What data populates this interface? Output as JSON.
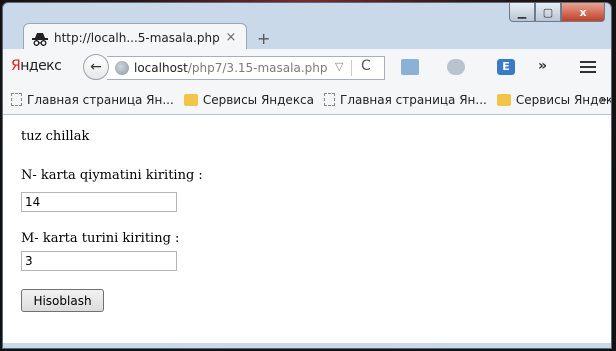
{
  "window": {
    "minimize_icon": "minimize-icon",
    "maximize_icon": "maximize-icon",
    "close_label": "x"
  },
  "tab": {
    "title": "http://localh...5-masala.php",
    "close_label": "×",
    "icon": "incognito-icon",
    "new_tab_label": "+"
  },
  "navbar": {
    "brand_first": "Я",
    "brand_rest": "ндекс",
    "back_label": "←",
    "url_host": "localhost",
    "url_path": "/php7/3.15-masala.php",
    "dropdown_label": "▽",
    "reload_label": "C",
    "ext_label": "E",
    "more_label": "»"
  },
  "bookmarks": {
    "items": [
      {
        "label": "Главная страница Ян...",
        "icon": "page-icon"
      },
      {
        "label": "Сервисы Яндекса",
        "icon": "folder-icon"
      },
      {
        "label": "Главная страница Ян...",
        "icon": "page-icon"
      },
      {
        "label": "Сервисы Яндекса",
        "icon": "folder-icon"
      }
    ],
    "overflow_label": "»"
  },
  "page": {
    "heading": "tuz chillak",
    "n_label": "N- karta qiymatini kiriting :",
    "n_value": "14",
    "m_label": "M- karta turini kiriting :",
    "m_value": "3",
    "submit_label": "Hisoblash"
  }
}
